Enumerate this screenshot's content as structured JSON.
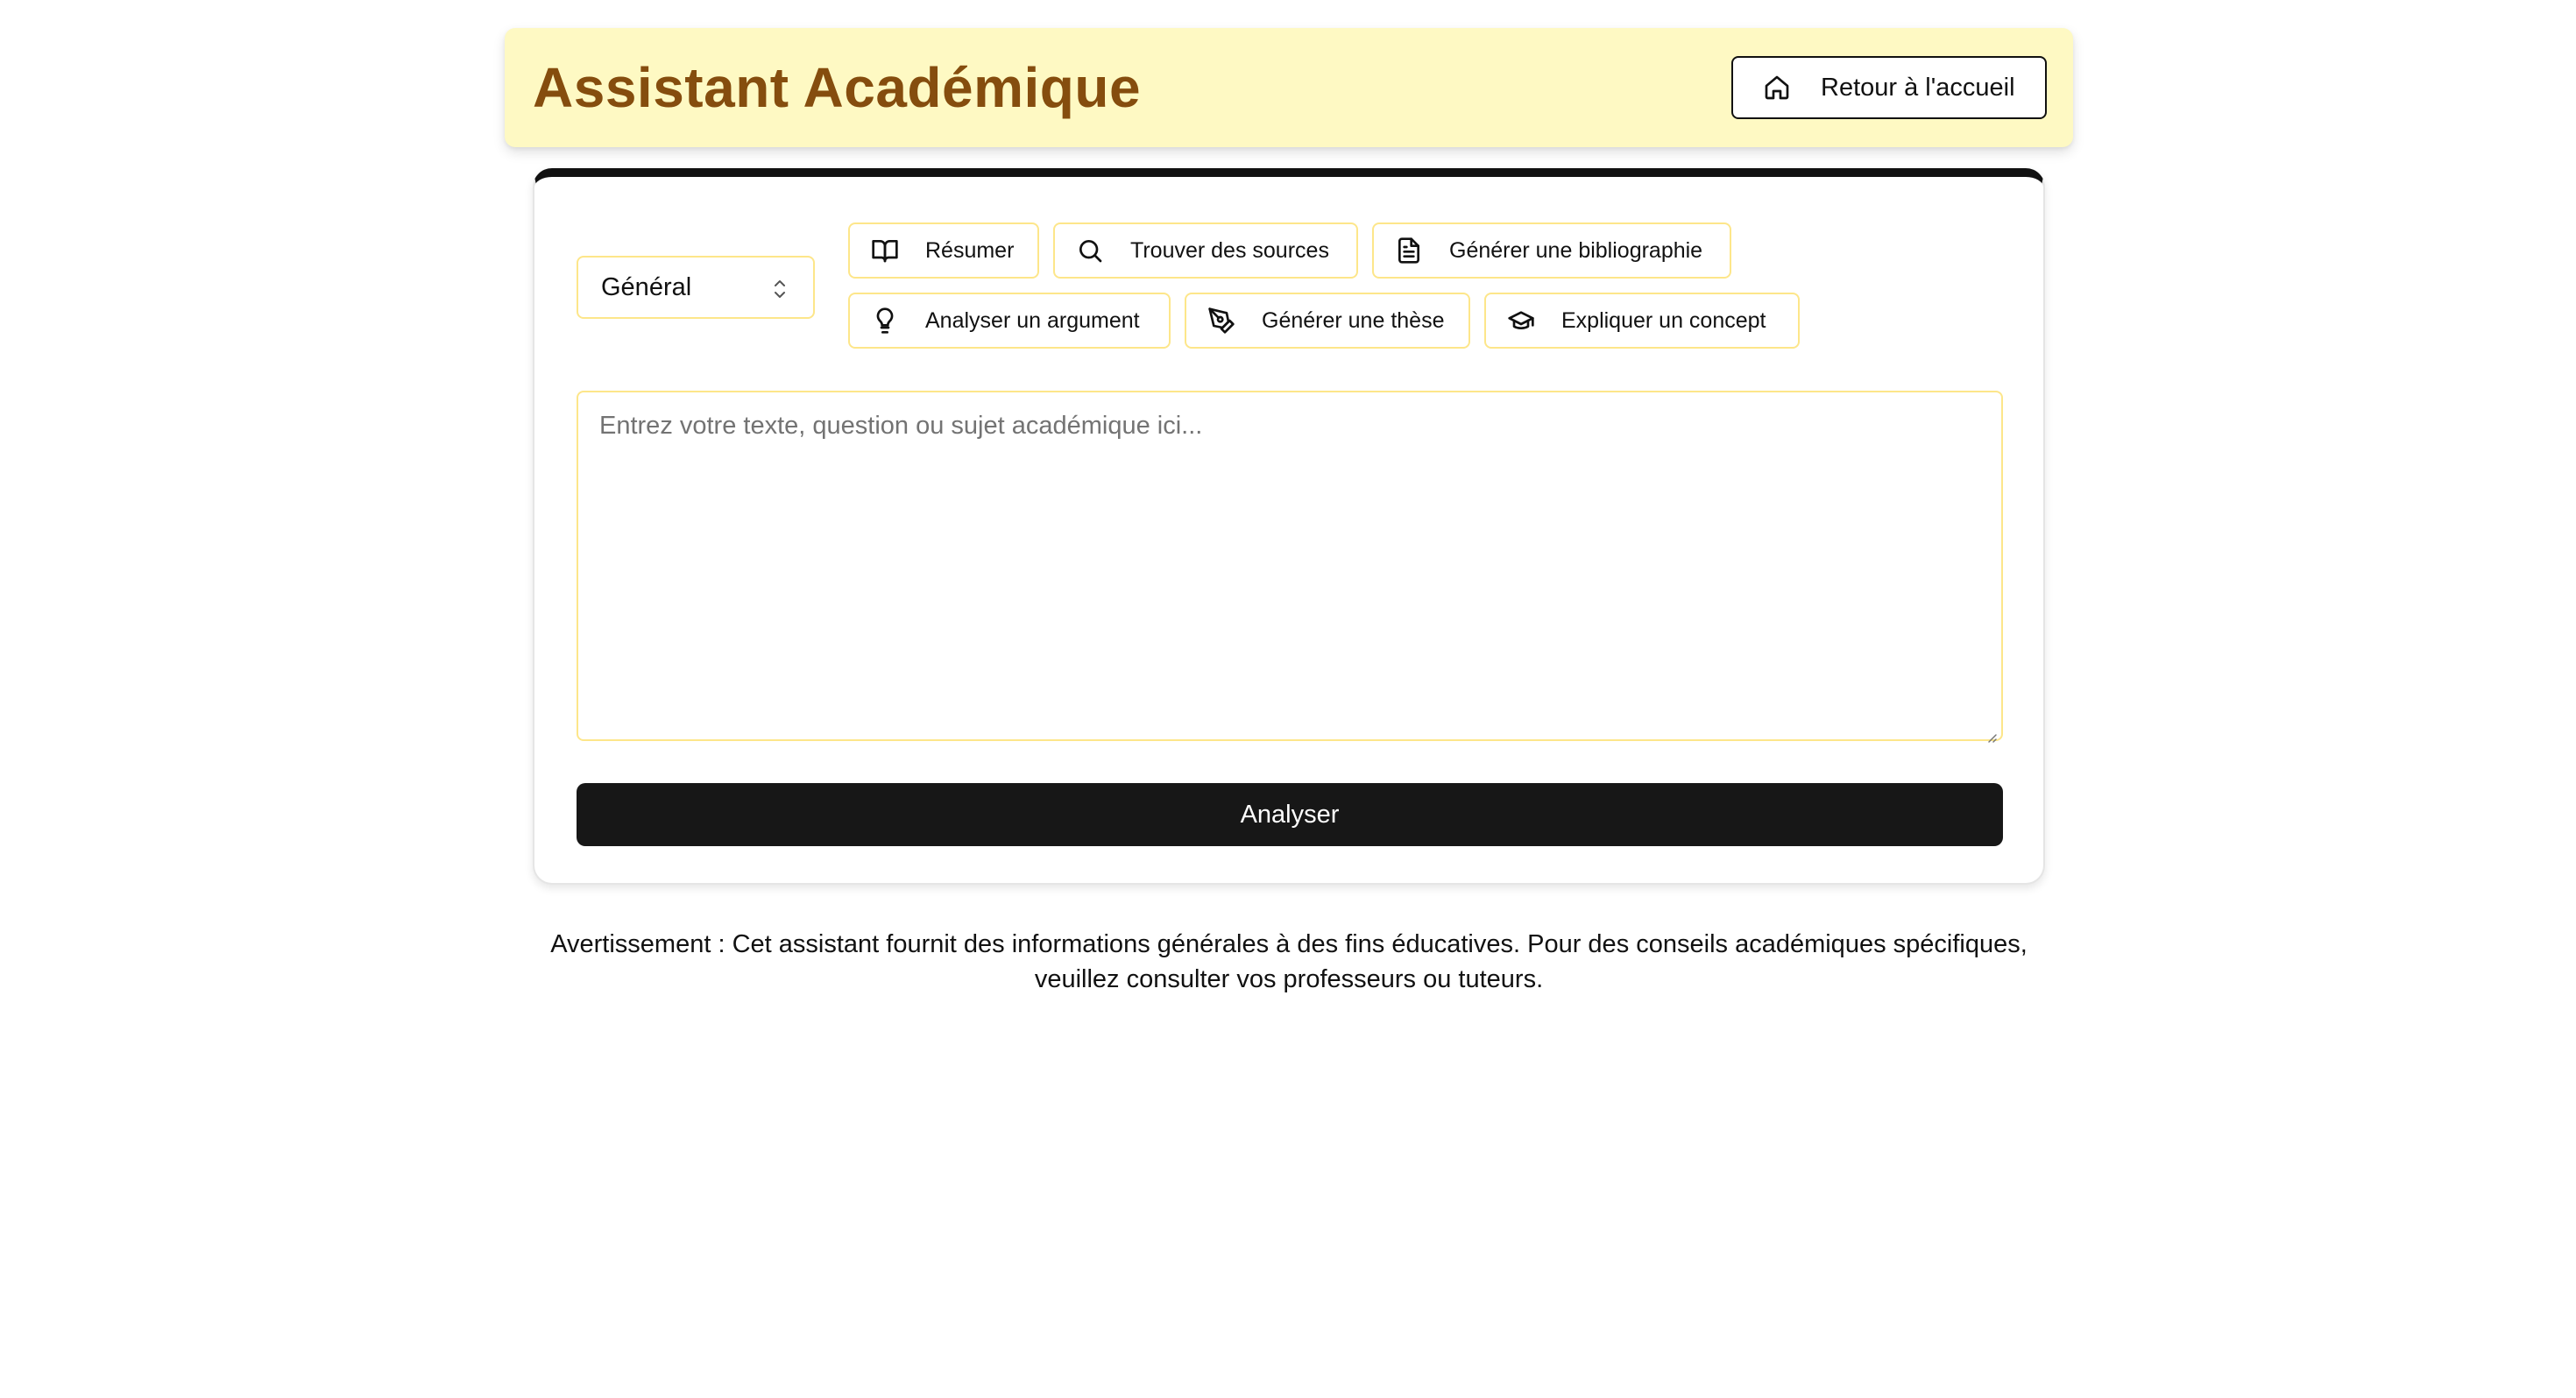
{
  "header": {
    "title": "Assistant Académique",
    "home_button": {
      "label": "Retour à l'accueil",
      "icon": "home-icon"
    }
  },
  "form": {
    "category_select": {
      "value": "Général",
      "icon": "chevrons-up-down-icon"
    },
    "tools": [
      {
        "label": "Résumer",
        "icon": "book-open-icon"
      },
      {
        "label": "Trouver des sources",
        "icon": "search-icon"
      },
      {
        "label": "Générer une bibliographie",
        "icon": "file-text-icon"
      },
      {
        "label": "Analyser un argument",
        "icon": "lightbulb-icon"
      },
      {
        "label": "Générer une thèse",
        "icon": "pen-tool-icon"
      },
      {
        "label": "Expliquer un concept",
        "icon": "graduation-cap-icon"
      }
    ],
    "input": {
      "placeholder": "Entrez votre texte, question ou sujet académique ici...",
      "value": ""
    },
    "submit_label": "Analyser"
  },
  "disclaimer": {
    "line1": "Avertissement : Cet assistant fournit des informations générales à des fins éducatives. Pour des conseils académiques spécifiques,",
    "line2": "veuillez consulter vos professeurs ou tuteurs."
  },
  "colors": {
    "header_bg": "#fef9c3",
    "title": "#854d0e",
    "accent_border": "#fde68a",
    "primary_button": "#171717"
  }
}
